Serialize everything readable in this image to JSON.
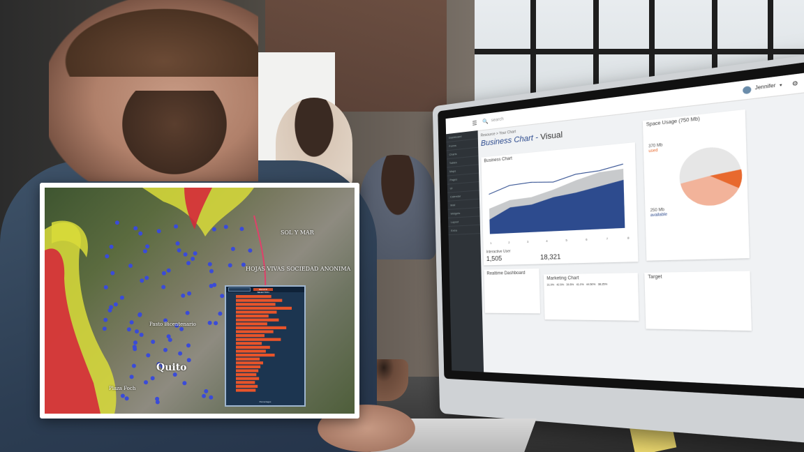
{
  "screen_ui": {
    "search_placeholder": "search",
    "user_name": "Jennifer",
    "breadcrumb": "Resource > Your Chart",
    "page_title_main": "Business Chart",
    "page_title_sep": " - ",
    "page_title_accent": "Visual",
    "business_chart_title": "Business Chart",
    "x_ticks": [
      "1",
      "2",
      "3",
      "4",
      "5",
      "6",
      "7",
      "8"
    ],
    "interactive_user_label": "Interactive User",
    "interactive_user_value": "1,505",
    "stat_two_value": "18,321",
    "space_usage_title": "Space Usage (750 Mb)",
    "used_value": "370 Mb",
    "used_label": "used",
    "available_value": "250 Mb",
    "available_label": "available",
    "realtime_title": "Realtime Dashboard",
    "marketing_title": "Marketing Chart",
    "marketing_percents": [
      "31.0%",
      "42.5%",
      "39.5%",
      "41.0%",
      "44.50%",
      "38.25%"
    ],
    "target_title": "Target",
    "nav_items": [
      "Dashboard",
      "Forms",
      "Charts",
      "Tables",
      "Maps",
      "Pages",
      "UI",
      "Calendar",
      "Mail",
      "Widgets",
      "Layout",
      "Extra"
    ],
    "colors": {
      "accent_blue": "#2d4b8e",
      "orange": "#e8692e",
      "nav_bg": "#2e3338"
    }
  },
  "map_inset": {
    "city_label": "Quito",
    "place_labels": [
      "SOL Y MAR",
      "HOJAS VIVAS SOCIEDAD ANONIMA",
      "Plaza Foch",
      "Pasto Bicentenario"
    ],
    "popup_button": "REGION SELECTION",
    "popup_footer": "Percentages",
    "bar_values": [
      52,
      68,
      58,
      82,
      60,
      48,
      63,
      46,
      74,
      55,
      42,
      66,
      38,
      50,
      44,
      57,
      35,
      40,
      36,
      33,
      30,
      34,
      28,
      32,
      29
    ],
    "colors": {
      "hazard_red": "#d42a3a",
      "hazard_yellow": "#d9dc3a",
      "marker_blue": "#3a4bd8",
      "bar_orange": "#e8542a"
    }
  }
}
